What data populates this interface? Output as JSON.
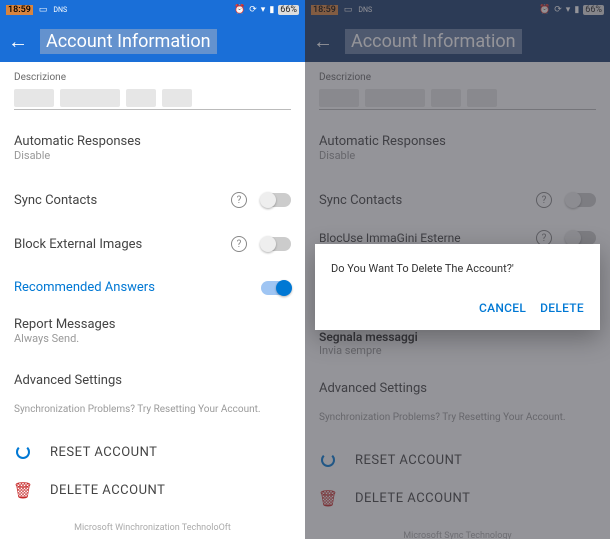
{
  "left": {
    "status": {
      "time": "18:59",
      "battery": "66%"
    },
    "appbar": {
      "title": "Account Information"
    },
    "desc_label": "Descrizione",
    "auto_responses": {
      "label": "Automatic Responses",
      "value": "Disable"
    },
    "sync_contacts": {
      "label": "Sync Contacts"
    },
    "block_images": {
      "label": "Block External Images"
    },
    "recommended": {
      "label": "Recommended Answers"
    },
    "report": {
      "label": "Report Messages",
      "sub": "Always Send."
    },
    "advanced": "Advanced Settings",
    "sync_problem": "Synchronization Problems? Try Resetting Your Account.",
    "reset": "RESET ACCOUNT",
    "delete": "DELETE ACCOUNT",
    "footer": "Microsoft Winchronization TechnoloOft"
  },
  "right": {
    "status": {
      "time": "18:59",
      "battery": "66%"
    },
    "appbar": {
      "title": "Account Information"
    },
    "desc_label": "Descrizione",
    "auto_responses": {
      "label": "Automatic Responses",
      "value": "Disable"
    },
    "sync_contacts": {
      "label": "Sync Contacts"
    },
    "block_images": {
      "label": "BlocUse ImmaGini Esterne"
    },
    "report": {
      "label": "Segnala messaggi",
      "sub": "Invia sempre"
    },
    "advanced": "Advanced Settings",
    "sync_problem": "Synchronization Problems? Try Resetting Your Account.",
    "reset": "RESET ACCOUNT",
    "delete": "DELETE ACCOUNT",
    "footer": "Microsoft Sync Technology",
    "dialog": {
      "message": "Do You Want To Delete The Account?'",
      "cancel": "CANCEL",
      "confirm": "DELETE"
    }
  }
}
